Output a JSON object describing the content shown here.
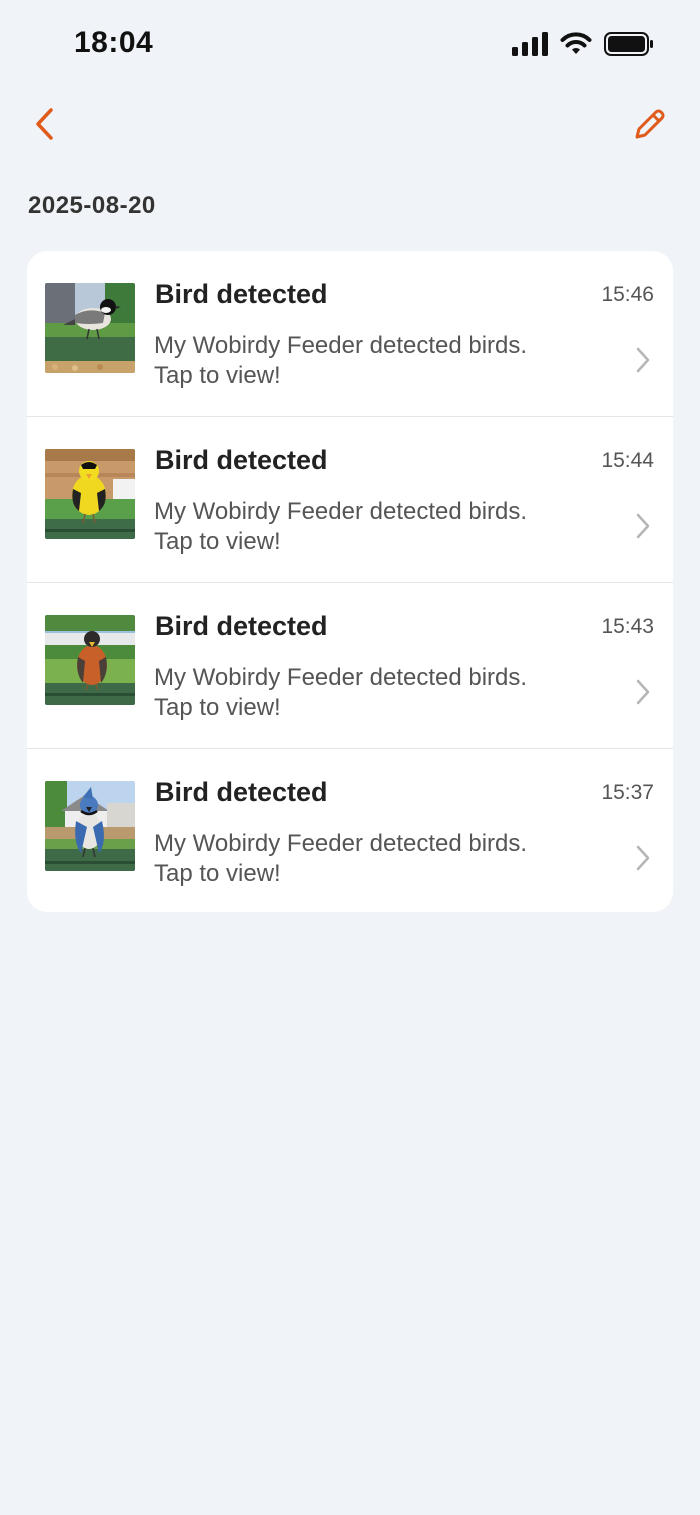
{
  "status_bar": {
    "time": "18:04",
    "signal_icon": "cellular-signal-icon",
    "wifi_icon": "wifi-icon",
    "battery_icon": "battery-full-icon"
  },
  "nav": {
    "back_icon": "chevron-left-icon",
    "edit_icon": "pencil-icon",
    "accent_color": "#e05a1c"
  },
  "date_header": "2025-08-20",
  "notifications": [
    {
      "title": "Bird detected",
      "time": "15:46",
      "line1": "My Wobirdy Feeder detected birds.",
      "line2": "Tap to view!",
      "thumb": "chickadee-thumbnail"
    },
    {
      "title": "Bird detected",
      "time": "15:44",
      "line1": "My Wobirdy Feeder detected birds.",
      "line2": "Tap to view!",
      "thumb": "goldfinch-thumbnail"
    },
    {
      "title": "Bird detected",
      "time": "15:43",
      "line1": "My Wobirdy Feeder detected birds.",
      "line2": "Tap to view!",
      "thumb": "robin-thumbnail"
    },
    {
      "title": "Bird detected",
      "time": "15:37",
      "line1": "My Wobirdy Feeder detected birds.",
      "line2": "Tap to view!",
      "thumb": "blue-jay-thumbnail"
    }
  ]
}
